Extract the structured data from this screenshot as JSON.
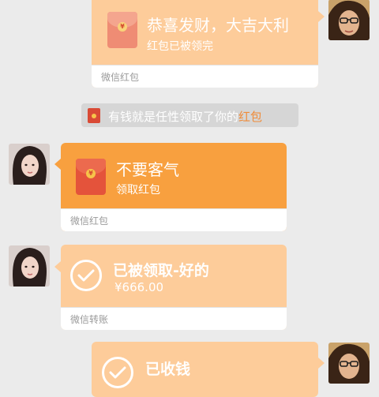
{
  "messages": [
    {
      "title": "恭喜发财，大吉大利",
      "subtitle": "红包已被领完",
      "footer": "微信红包"
    },
    {
      "title": "不要客气",
      "subtitle": "领取红包",
      "footer": "微信红包"
    },
    {
      "title": "已被领取-好的",
      "subtitle": "¥666.00",
      "footer": "微信转账"
    },
    {
      "title": "已收钱"
    }
  ],
  "system_notice": {
    "prefix": "有钱就是任性领取了你的",
    "highlight": "红包"
  },
  "colors": {
    "claimed_card": "#fdcc9a",
    "active_card": "#f8a03f",
    "envelope": "#e4533b",
    "background": "#ebebeb"
  },
  "icons": {
    "envelope": "red-envelope-icon",
    "check": "check-circle-icon"
  }
}
